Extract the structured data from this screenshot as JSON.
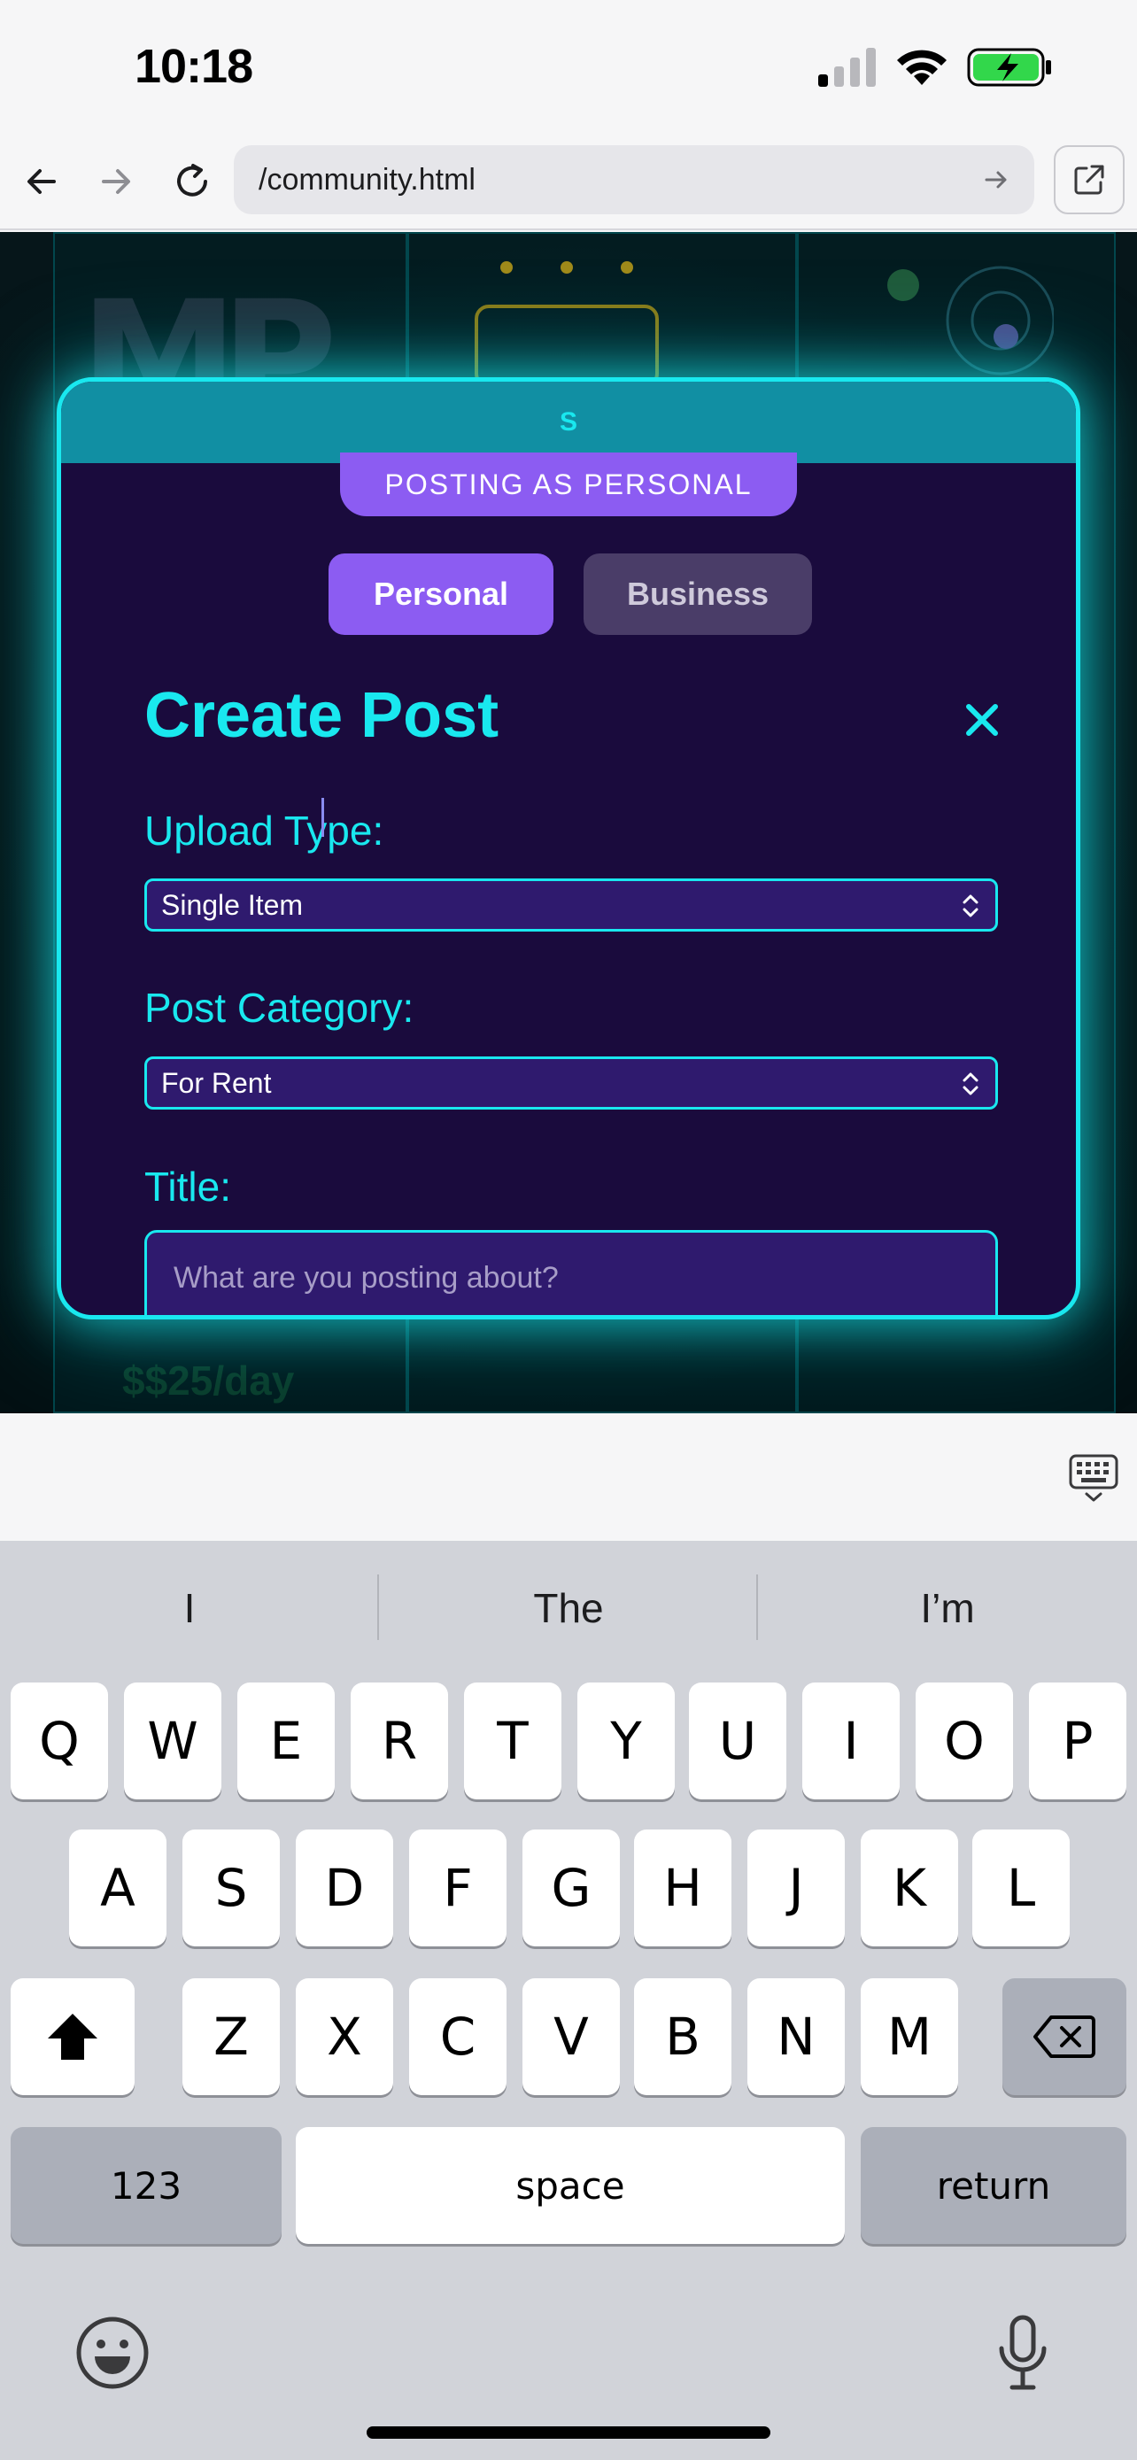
{
  "status_bar": {
    "time": "10:18"
  },
  "browser": {
    "url": "/community.html"
  },
  "background": {
    "price_text": "$$25/day"
  },
  "modal": {
    "header_letter": "S",
    "posting_badge": "POSTING AS PERSONAL",
    "segments": [
      {
        "label": "Personal",
        "selected": true
      },
      {
        "label": "Business",
        "selected": false
      }
    ],
    "title": "Create Post",
    "fields": {
      "upload_type": {
        "label": "Upload Type:",
        "value": "Single Item"
      },
      "post_category": {
        "label": "Post Category:",
        "value": "For Rent"
      },
      "title": {
        "label": "Title:",
        "placeholder": "What are you posting about?"
      }
    }
  },
  "keyboard": {
    "suggestions": [
      "I",
      "The",
      "I’m"
    ],
    "row1": [
      "Q",
      "W",
      "E",
      "R",
      "T",
      "Y",
      "U",
      "I",
      "O",
      "P"
    ],
    "row2": [
      "A",
      "S",
      "D",
      "F",
      "G",
      "H",
      "J",
      "K",
      "L"
    ],
    "row3": [
      "Z",
      "X",
      "C",
      "V",
      "B",
      "N",
      "M"
    ],
    "numbers_label": "123",
    "space_label": "space",
    "return_label": "return"
  },
  "colors": {
    "accent_cyan": "#19e8ef",
    "accent_purple": "#8c5cf2",
    "modal_bg": "#1a0b3d"
  },
  "icons": [
    "back-icon",
    "forward-icon",
    "reload-icon",
    "go-icon",
    "open-external-icon",
    "close-icon",
    "chevron-updown-icon",
    "keyboard-hide-icon",
    "shift-icon",
    "delete-icon",
    "emoji-icon",
    "microphone-icon"
  ]
}
